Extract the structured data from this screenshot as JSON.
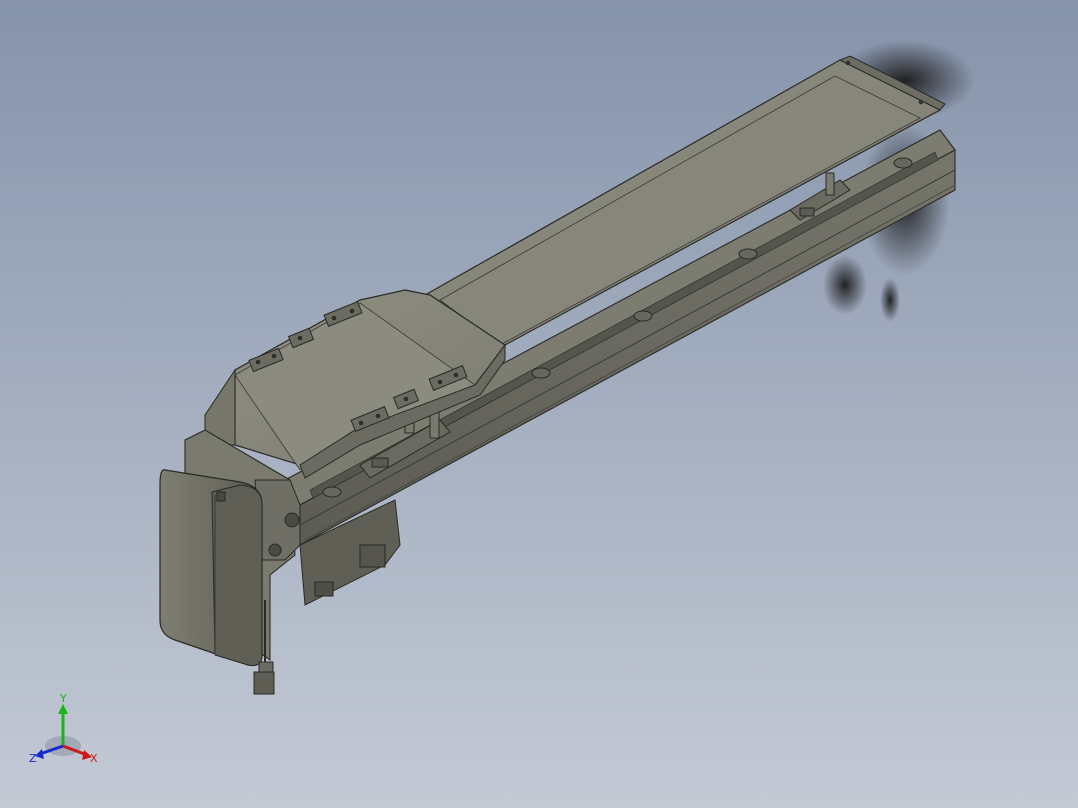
{
  "viewport": {
    "background_top": "#8593ab",
    "background_bottom": "#c4cad5"
  },
  "model": {
    "body_color": "#8a8a7e",
    "dark_color": "#55554d",
    "light_color": "#a0a094",
    "edge_color": "#2a2a26"
  },
  "triad": {
    "x_label": "X",
    "y_label": "Y",
    "z_label": "Z",
    "x_color": "#d01818",
    "y_color": "#18b418",
    "z_color": "#1828d0"
  }
}
